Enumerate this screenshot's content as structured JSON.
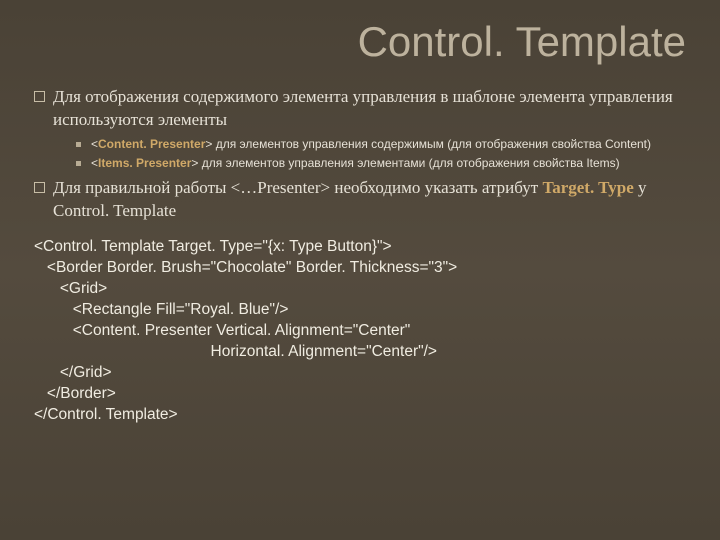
{
  "title": "Control. Template",
  "bullets": [
    {
      "text": "Для отображения содержимого элемента управления в шаблоне элемента управления используются элементы",
      "subs": [
        {
          "prefix": "<",
          "keyword": "Content. Presenter",
          "suffix": "> для элементов управления содержимым (для отображения свойства Content)"
        },
        {
          "prefix": "<",
          "keyword": "Items. Presenter",
          "suffix": "> для элементов управления элементами (для отображения свойства Items)"
        }
      ]
    },
    {
      "text_pre": "Для правильной работы <…Presenter> необходимо указать атрибут ",
      "keyword": "Target. Type",
      "text_post": " у Control. Template"
    }
  ],
  "code": {
    "l1": "<Control. Template Target. Type=\"{x: Type Button}\">",
    "l2": "   <Border Border. Brush=\"Chocolate\" Border. Thickness=\"3\">",
    "l3": "      <Grid>",
    "l4": "         <Rectangle Fill=\"Royal. Blue\"/>",
    "l5": "         <Content. Presenter Vertical. Alignment=\"Center\"",
    "l6": "                                         Horizontal. Alignment=\"Center\"/>",
    "l7": "      </Grid>",
    "l8": "   </Border>",
    "l9": "</Control. Template>"
  }
}
